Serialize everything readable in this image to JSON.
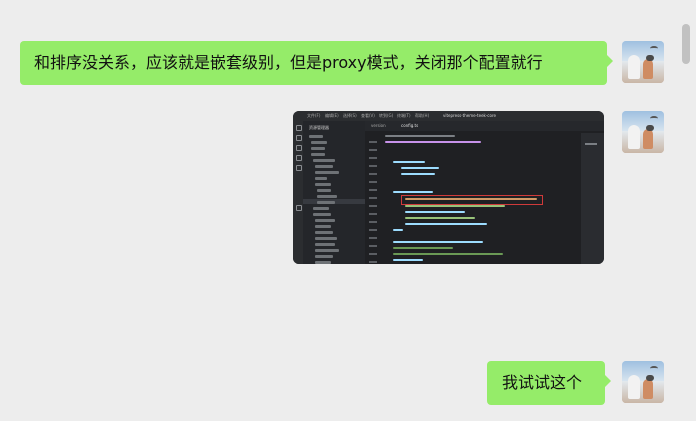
{
  "messages": [
    {
      "sender": "self",
      "type": "text",
      "text": "和排序没关系，应该就是嵌套级别，但是proxy模式，关闭那个配置就行"
    },
    {
      "sender": "self",
      "type": "image",
      "image_description_label": ""
    },
    {
      "sender": "self",
      "type": "text",
      "text": "我试试这个"
    }
  ],
  "screenshot_contents": {
    "menu_items": [
      "文件(F)",
      "编辑(E)",
      "选择(S)",
      "查看(V)",
      "转到(G)",
      "终端(T)",
      "帮助(H)"
    ],
    "window_title": "vitepress-theme-teek-core",
    "tabs": [
      "version",
      "config.ts"
    ],
    "sidebar_title": "资源管理器",
    "code_highlight_line": "autoIndex: false,"
  },
  "colors": {
    "bubble": "#95ec69",
    "background": "#ededed",
    "editor_bg": "#1f2023",
    "highlight_box": "#d03a3a"
  }
}
